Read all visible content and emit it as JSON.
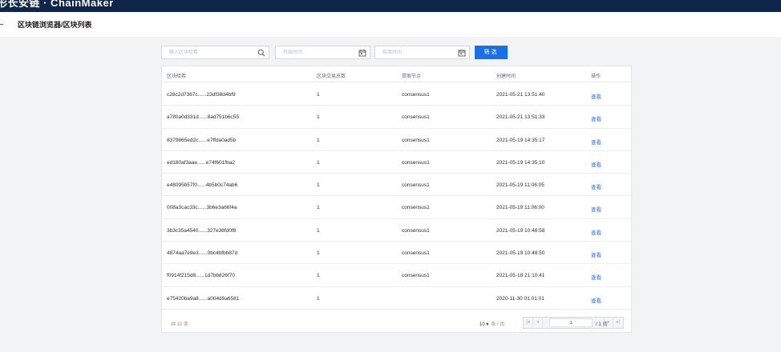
{
  "header": {
    "brand": "形长安链 · ChainMaker"
  },
  "breadcrumb": {
    "text": "区块链浏览器/区块列表"
  },
  "filters": {
    "search_placeholder": "输入区块哈希",
    "start_placeholder": "开始时间",
    "end_placeholder": "结束时间",
    "filter_label": "筛选"
  },
  "table": {
    "columns": [
      "区块哈希",
      "区块交易总数",
      "提案节点",
      "创建时间",
      "操作"
    ],
    "rows": [
      {
        "hash": "c28c2d7367c......23df38d4bf9",
        "tx_count": "1",
        "proposer": "consensus1",
        "time": "2021-05-21 13:51:40",
        "action": "查看"
      },
      {
        "hash": "a780a0d331d......8ad751b6c55",
        "tx_count": "1",
        "proposer": "consensus1",
        "time": "2021-05-21 13:51:33",
        "action": "查看"
      },
      {
        "hash": "8379865ed2c......e7ffda0ad5b",
        "tx_count": "1",
        "proposer": "consensus1",
        "time": "2021-05-19 14:35:17",
        "action": "查看"
      },
      {
        "hash": "ed180af3aae......e74f601fba2",
        "tx_count": "1",
        "proposer": "consensus1",
        "time": "2021-05-19 14:35:10",
        "action": "查看"
      },
      {
        "hash": "e48095b57f0......4b5b0c74ab6",
        "tx_count": "1",
        "proposer": "consensus1",
        "time": "2021-05-19 11:06:05",
        "action": "查看"
      },
      {
        "hash": "008a3cac33c......3b6e3a66f4a",
        "tx_count": "1",
        "proposer": "consensus1",
        "time": "2021-05-19 11:06:00",
        "action": "查看"
      },
      {
        "hash": "3b3c35a4540......327e38fd0f8",
        "tx_count": "1",
        "proposer": "consensus1",
        "time": "2021-05-19 10:48:58",
        "action": "查看"
      },
      {
        "hash": "4874aa7e9e3......0bc4bfbb87d",
        "tx_count": "1",
        "proposer": "consensus1",
        "time": "2021-05-19 10:48:50",
        "action": "查看"
      },
      {
        "hash": "f0914f215d8......1d7bb826f70",
        "tx_count": "1",
        "proposer": "consensus1",
        "time": "2021-05-18 21:10:41",
        "action": "查看"
      },
      {
        "hash": "e75420ba9a8......a004d9a6581",
        "tx_count": "1",
        "proposer": "",
        "time": "2020-11-30 01:01:01",
        "action": "查看"
      }
    ]
  },
  "pagination": {
    "total_text": "共 10 条",
    "page_size": "10 ▾",
    "page_size_unit": "条 / 页",
    "current_page": "1",
    "total_pages_text": "/ 1 页"
  },
  "colors": {
    "navbar": "#10254a",
    "accent": "#1a6fe8",
    "link": "#2e6ee6",
    "background": "#f2f3f5"
  },
  "icons": {
    "search": "search-icon",
    "calendar": "calendar-icon"
  }
}
